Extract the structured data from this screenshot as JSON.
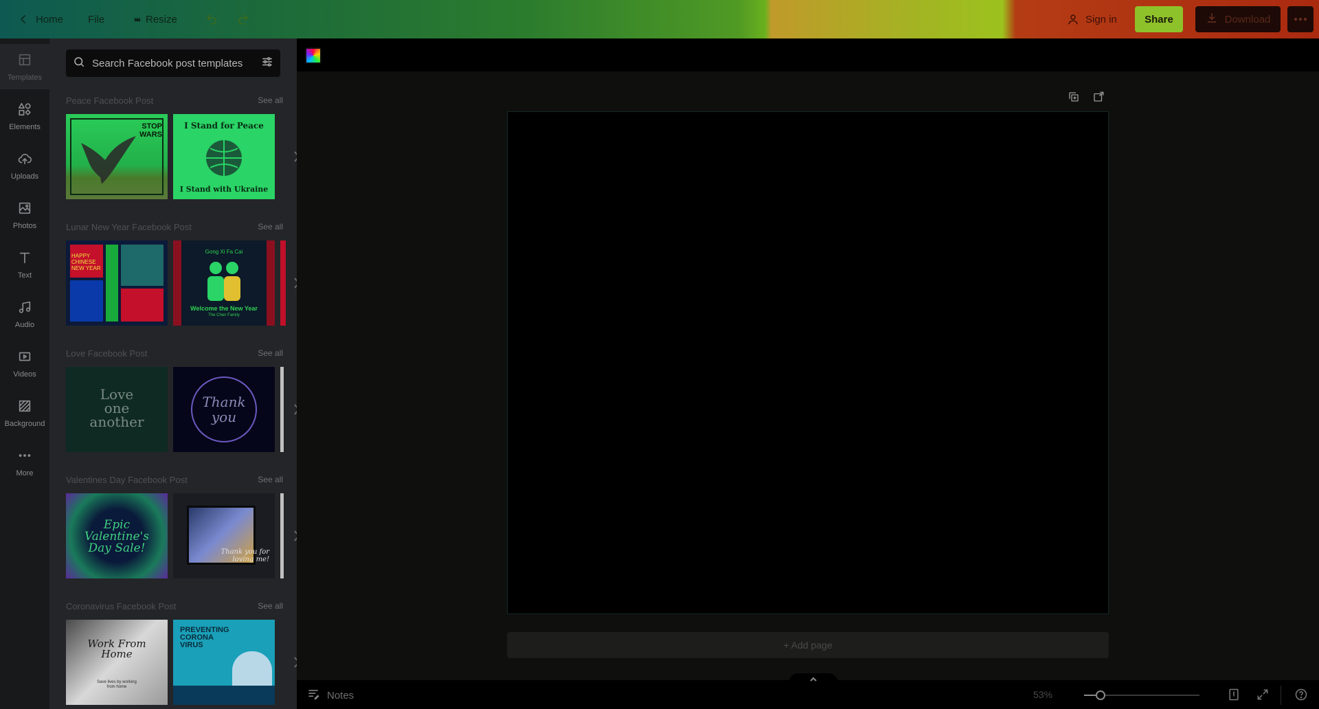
{
  "topbar": {
    "home_label": "Home",
    "file_label": "File",
    "resize_label": "Resize",
    "sign_in_label": "Sign in",
    "share_label": "Share",
    "download_label": "Download"
  },
  "rail": {
    "items": [
      {
        "label": "Templates",
        "icon": "templates-icon"
      },
      {
        "label": "Elements",
        "icon": "elements-icon"
      },
      {
        "label": "Uploads",
        "icon": "uploads-icon"
      },
      {
        "label": "Photos",
        "icon": "photos-icon"
      },
      {
        "label": "Text",
        "icon": "text-icon"
      },
      {
        "label": "Audio",
        "icon": "audio-icon"
      },
      {
        "label": "Videos",
        "icon": "videos-icon"
      },
      {
        "label": "Background",
        "icon": "background-icon"
      },
      {
        "label": "More",
        "icon": "more-icon"
      }
    ]
  },
  "panel": {
    "search_placeholder": "Search Facebook post templates",
    "see_all_label": "See all",
    "sections": [
      {
        "title": "Peace Facebook Post",
        "thumbs": [
          {
            "lines": [
              "STOP",
              "WARS"
            ]
          },
          {
            "lines": [
              "I Stand for Peace",
              "I Stand with Ukraine"
            ]
          }
        ]
      },
      {
        "title": "Lunar New Year Facebook Post",
        "thumbs": [
          {
            "lines": [
              "HAPPY",
              "CHINESE",
              "NEW YEAR"
            ]
          },
          {
            "lines": [
              "Gong Xi Fa Cai",
              "Welcome the New Year",
              "The Chen Family"
            ]
          }
        ]
      },
      {
        "title": "Love Facebook Post",
        "thumbs": [
          {
            "lines": [
              "Love",
              "one",
              "another"
            ]
          },
          {
            "lines": [
              "Thank",
              "you"
            ]
          }
        ]
      },
      {
        "title": "Valentines Day Facebook Post",
        "thumbs": [
          {
            "lines": [
              "Epic",
              "Valentine's",
              "Day Sale!"
            ]
          },
          {
            "lines": [
              "Thank you for",
              "loving me!"
            ]
          }
        ]
      },
      {
        "title": "Coronavirus Facebook Post",
        "thumbs": [
          {
            "lines": [
              "Work From",
              "Home",
              "Save lives by working",
              "from home"
            ]
          },
          {
            "lines": [
              "PREVENTING",
              "CORONA",
              "VIRUS"
            ]
          }
        ]
      }
    ]
  },
  "editor": {
    "add_page_label": "+ Add page"
  },
  "footer": {
    "notes_label": "Notes",
    "zoom_label": "53%",
    "zoom_fraction": 0.14
  }
}
